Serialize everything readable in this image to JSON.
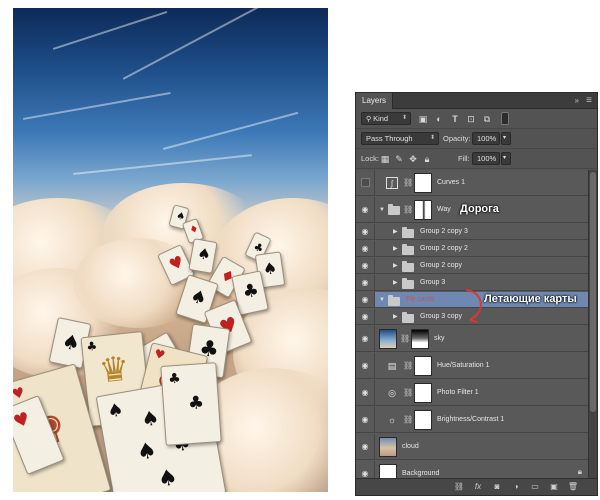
{
  "panel": {
    "tab_label": "Layers",
    "collapse_glyph": "»",
    "menu_glyph": "≡",
    "filter_kind": "Kind",
    "blend_mode": "Pass Through",
    "opacity_label": "Opacity:",
    "opacity_value": "100%",
    "lock_label": "Lock:",
    "fill_label": "Fill:",
    "fill_value": "100%"
  },
  "layers": [
    {
      "name": "Curves 1",
      "kind": "adjustment",
      "icon": "curves-icon",
      "visible": false
    },
    {
      "name": "Way",
      "kind": "group-open",
      "visible": true,
      "annotation": "Дорога"
    },
    {
      "name": "Group 2 copy 3",
      "kind": "group-closed",
      "visible": true
    },
    {
      "name": "Group 2 copy 2",
      "kind": "group-closed",
      "visible": true
    },
    {
      "name": "Group 2 copy",
      "kind": "group-closed",
      "visible": true
    },
    {
      "name": "Group 3",
      "kind": "group-closed",
      "visible": true
    },
    {
      "name": "Fly cards",
      "kind": "group-open-selected",
      "visible": true,
      "annotation": "Летающие карты"
    },
    {
      "name": "Group 3 copy",
      "kind": "group-closed",
      "visible": true
    },
    {
      "name": "sky",
      "kind": "image-mask",
      "visible": true
    },
    {
      "name": "Hue/Saturation 1",
      "kind": "adjustment",
      "icon": "hue-saturation-icon",
      "visible": true
    },
    {
      "name": "Photo Filter 1",
      "kind": "adjustment",
      "icon": "photo-filter-icon",
      "visible": true
    },
    {
      "name": "Brightness/Contrast 1",
      "kind": "adjustment",
      "icon": "brightness-contrast-icon",
      "visible": true
    },
    {
      "name": "cloud",
      "kind": "image",
      "visible": true
    },
    {
      "name": "Background",
      "kind": "background",
      "visible": true
    }
  ],
  "footer_icons": [
    "link-icon",
    "fx-icon",
    "mask-icon",
    "adjustment-icon",
    "folder-icon",
    "new-layer-icon",
    "trash-icon"
  ],
  "colors": {
    "panel_bg": "#535353",
    "selected_row": "#6e88b1",
    "annotation_arrow": "#d23a3a"
  }
}
